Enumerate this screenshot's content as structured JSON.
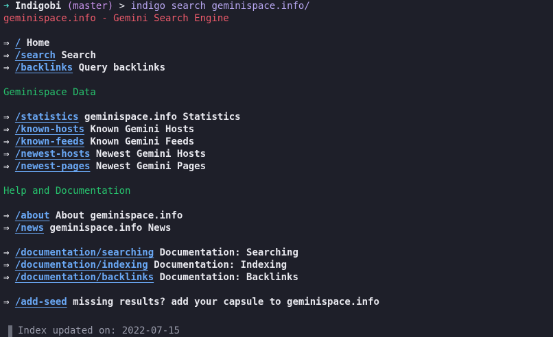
{
  "prompt": {
    "arrow": "➜",
    "user": "Indigobi",
    "branch": "(master)",
    "gt": ">",
    "command": "indigo search geminispace.info/"
  },
  "title": "geminispace.info - Gemini Search Engine",
  "link_arrow": "⇒",
  "nav": [
    {
      "href": "/",
      "text": "Home"
    },
    {
      "href": "/search",
      "text": "Search"
    },
    {
      "href": "/backlinks",
      "text": "Query backlinks"
    }
  ],
  "section_data": {
    "heading": "Geminispace Data",
    "links": [
      {
        "href": "/statistics",
        "text": "geminispace.info Statistics"
      },
      {
        "href": "/known-hosts",
        "text": "Known Gemini Hosts"
      },
      {
        "href": "/known-feeds",
        "text": "Known Gemini Feeds"
      },
      {
        "href": "/newest-hosts",
        "text": "Newest Gemini Hosts"
      },
      {
        "href": "/newest-pages",
        "text": "Newest Gemini Pages"
      }
    ]
  },
  "section_help": {
    "heading": "Help and Documentation",
    "links_a": [
      {
        "href": "/about",
        "text": "About geminispace.info"
      },
      {
        "href": "/news",
        "text": "geminispace.info News"
      }
    ],
    "links_b": [
      {
        "href": "/documentation/searching",
        "text": "Documentation: Searching"
      },
      {
        "href": "/documentation/indexing",
        "text": "Documentation: Indexing"
      },
      {
        "href": "/documentation/backlinks",
        "text": "Documentation: Backlinks"
      }
    ],
    "seed": {
      "href": "/add-seed",
      "text": "missing results? add your capsule to geminispace.info"
    }
  },
  "footer_quote": "Index updated on: 2022-07-15"
}
